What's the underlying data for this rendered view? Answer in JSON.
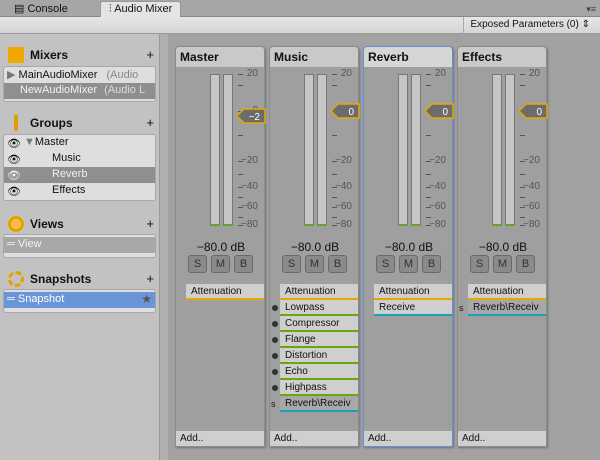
{
  "tabs": [
    {
      "label": "Console",
      "icon": "console-icon"
    },
    {
      "label": "Audio Mixer",
      "icon": "mixer-icon",
      "active": true
    }
  ],
  "toolbar": {
    "exposed_parameters": "Exposed Parameters (0)"
  },
  "sidebar": {
    "mixers": {
      "title": "Mixers",
      "items": [
        {
          "name": "MainAudioMixer",
          "type": "(Audio"
        },
        {
          "name": "NewAudioMixer",
          "type": "(Audio L",
          "selected": true
        }
      ]
    },
    "groups": {
      "title": "Groups",
      "items": [
        {
          "name": "Master"
        },
        {
          "name": "Music"
        },
        {
          "name": "Reverb",
          "selected": true
        },
        {
          "name": "Effects"
        }
      ]
    },
    "views": {
      "title": "Views",
      "items": [
        {
          "name": "View"
        }
      ]
    },
    "snapshots": {
      "title": "Snapshots",
      "items": [
        {
          "name": "Snapshot"
        }
      ]
    }
  },
  "scale_labels": [
    "20",
    "0",
    "−20",
    "−40",
    "−60",
    "−80"
  ],
  "accent": "#e6a800",
  "strips": [
    {
      "name": "Master",
      "fader": "−2",
      "fader_db": -2,
      "level": "−80.0 dB",
      "buttons": [
        "S",
        "M",
        "B"
      ],
      "effects": [
        {
          "name": "Attenuation",
          "kind": "att"
        }
      ],
      "add": "Add.."
    },
    {
      "name": "Music",
      "fader": "0",
      "fader_db": 0,
      "level": "−80.0 dB",
      "buttons": [
        "S",
        "M",
        "B"
      ],
      "effects": [
        {
          "name": "Attenuation",
          "kind": "att"
        },
        {
          "name": "Lowpass",
          "kind": "green"
        },
        {
          "name": "Compressor",
          "kind": "green"
        },
        {
          "name": "Flange",
          "kind": "green"
        },
        {
          "name": "Distortion",
          "kind": "green"
        },
        {
          "name": "Echo",
          "kind": "green"
        },
        {
          "name": "Highpass",
          "kind": "green"
        },
        {
          "name": "Reverb\\Receiv",
          "kind": "send",
          "prefix": "s"
        }
      ],
      "add": "Add.."
    },
    {
      "name": "Reverb",
      "fader": "0",
      "fader_db": 0,
      "level": "−80.0 dB",
      "buttons": [
        "S",
        "M",
        "B"
      ],
      "selected": true,
      "effects": [
        {
          "name": "Attenuation",
          "kind": "att"
        },
        {
          "name": "Receive",
          "kind": "cyan"
        }
      ],
      "add": "Add.."
    },
    {
      "name": "Effects",
      "fader": "0",
      "fader_db": 0,
      "level": "−80.0 dB",
      "buttons": [
        "S",
        "M",
        "B"
      ],
      "effects": [
        {
          "name": "Attenuation",
          "kind": "att"
        },
        {
          "name": "Reverb\\Receiv",
          "kind": "send",
          "prefix": "s"
        }
      ],
      "add": "Add.."
    }
  ]
}
